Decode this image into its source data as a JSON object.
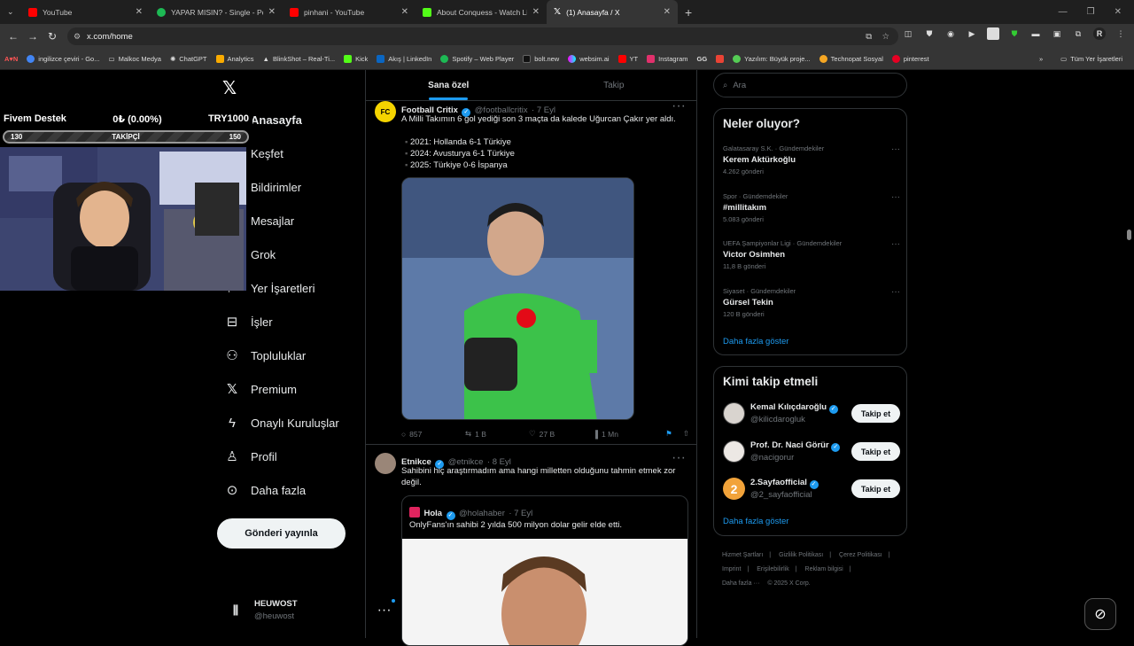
{
  "browser": {
    "tabs": [
      {
        "title": "YouTube",
        "color": "#ff0000"
      },
      {
        "title": "YAPAR MISIN? - Single - Poizi, I",
        "color": "#1db954"
      },
      {
        "title": "pinhani - YouTube",
        "color": "#ff0000"
      },
      {
        "title": "About Conquess - Watch Live o",
        "color": "#53fc18"
      },
      {
        "title": "(1) Anasayfa / X",
        "color": "#ffffff"
      }
    ],
    "url": "x.com/home",
    "bookmarks": [
      "A♥N",
      "ingilizce çeviri - Go...",
      "Malkoc Medya",
      "ChatGPT",
      "Analytics",
      "BlinkShot – Real-Ti...",
      "Kick",
      "Akış | LinkedIn",
      "Spotify – Web Player",
      "bolt.new",
      "websim.ai",
      "YT",
      "Instagram",
      "GG",
      "Yazılım: Büyük proje...",
      "Technopat Sosyal",
      "pinterest",
      "Tüm Yer İşaretleri"
    ]
  },
  "overlay": {
    "title": "Fivem Destek",
    "amount": "0₺ (0.00%)",
    "goal": "TRY1000",
    "progress_left": "130",
    "progress_label": "TAKİPÇİ",
    "progress_right": "150"
  },
  "nav": {
    "items": [
      "Anasayfa",
      "Keşfet",
      "Bildirimler",
      "Mesajlar",
      "Grok",
      "Yer İşaretleri",
      "İşler",
      "Topluluklar",
      "Premium",
      "Onaylı Kuruluşlar",
      "Profil",
      "Daha fazla"
    ],
    "post_button": "Gönderi yayınla",
    "account_name": "HEUWOST",
    "account_handle": "@heuwost"
  },
  "feed": {
    "tabs": [
      "Sana özel",
      "Takip"
    ],
    "tweet1": {
      "name": "Football Critix",
      "handle": "@footballcritix",
      "time": "· 7 Eyl",
      "text": "A Milli Takımın 6 gol yediği son 3 maçta da kalede Uğurcan Çakır yer aldı.",
      "list": [
        "2021: Hollanda 6-1 Türkiye",
        "2024: Avusturya 6-1 Türkiye",
        "2025: Türkiye 0-6 İspanya"
      ],
      "replies": "857",
      "reposts": "1 B",
      "likes": "27 B",
      "views": "1 Mn"
    },
    "tweet2": {
      "name": "Etnikce",
      "handle": "@etnikce",
      "time": "· 8 Eyl",
      "text": "Sahibini hiç araştırmadım ama hangi milletten olduğunu tahmin etmek zor değil.",
      "quote_name": "Hola",
      "quote_handle": "@holahaber",
      "quote_time": "· 7 Eyl",
      "quote_text": "OnlyFans'ın sahibi 2 yılda 500 milyon dolar gelir elde etti."
    }
  },
  "sidebar": {
    "search_placeholder": "Ara",
    "trends_title": "Neler oluyor?",
    "trends": [
      {
        "category": "Galatasaray S.K. · Gündemdekiler",
        "name": "Kerem Aktürkoğlu",
        "count": "4.262 gönderi"
      },
      {
        "category": "Spor · Gündemdekiler",
        "name": "#millitakım",
        "count": "5.083 gönderi"
      },
      {
        "category": "UEFA Şampiyonlar Ligi · Gündemdekiler",
        "name": "Victor Osimhen",
        "count": "11,8 B gönderi"
      },
      {
        "category": "Siyaset · Gündemdekiler",
        "name": "Gürsel Tekin",
        "count": "120 B gönderi"
      }
    ],
    "show_more": "Daha fazla göster",
    "who_to_follow_title": "Kimi takip etmeli",
    "suggestions": [
      {
        "name": "Kemal Kılıçdaroğlu",
        "handle": "@kilicdarogluk"
      },
      {
        "name": "Prof. Dr. Naci Görür",
        "handle": "@nacigorur"
      },
      {
        "name": "2.Sayfaofficial",
        "handle": "@2_sayfaofficial"
      }
    ],
    "follow_label": "Takip et",
    "footer": [
      "Hizmet Şartları",
      "Gizlilik Politikası",
      "Çerez Politikası",
      "Imprint",
      "Erişilebilirlik",
      "Reklam bilgisi",
      "Daha fazla ···",
      "© 2025 X Corp."
    ]
  }
}
